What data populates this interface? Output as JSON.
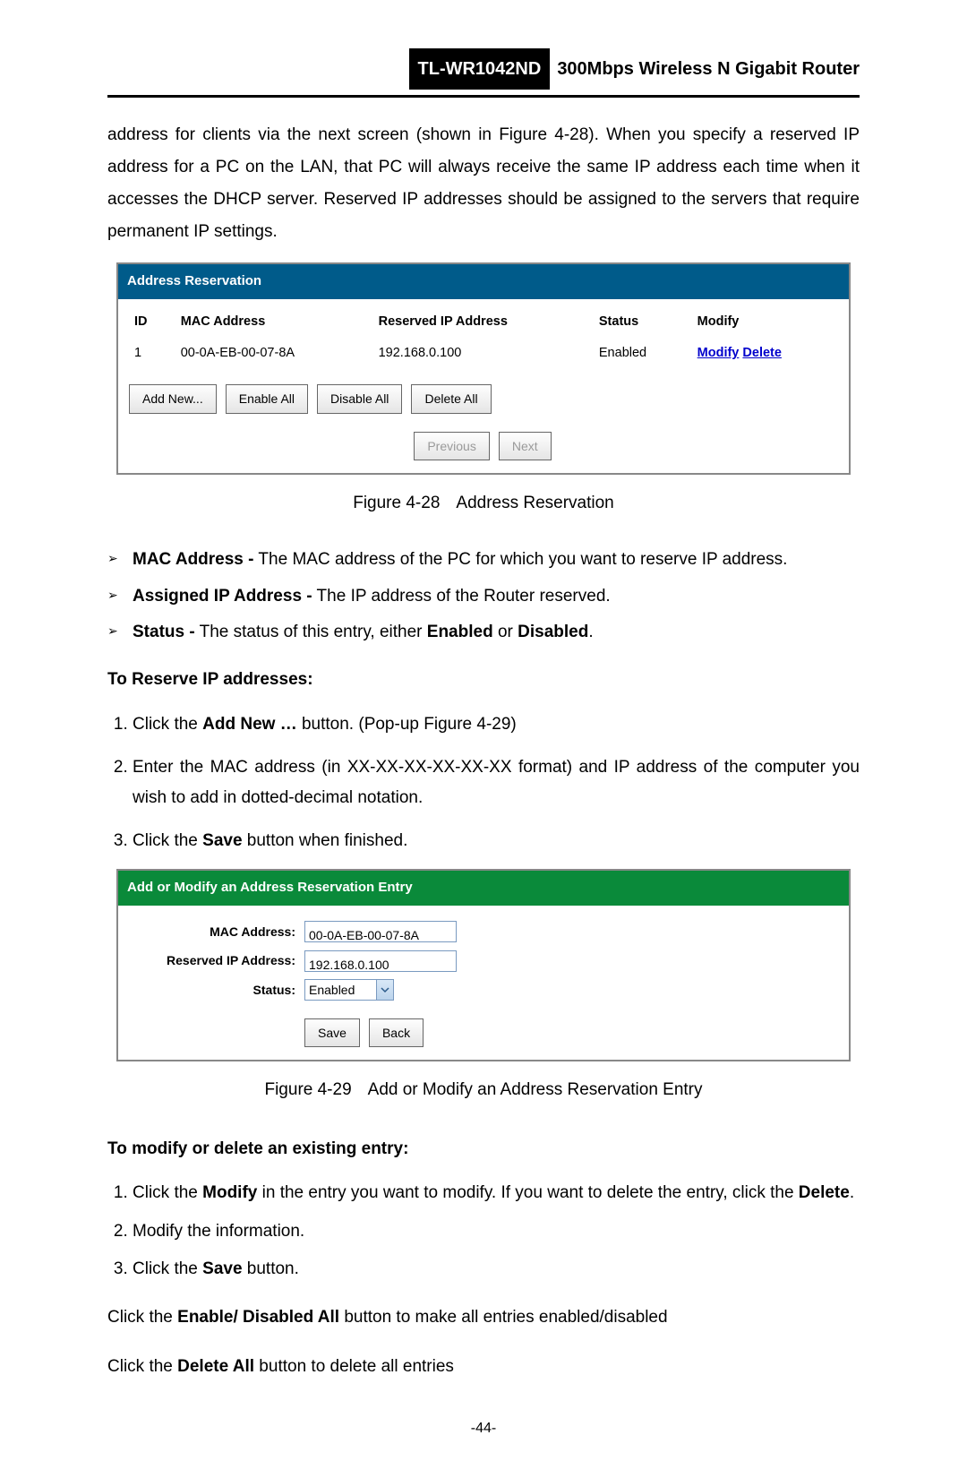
{
  "header": {
    "model": "TL-WR1042ND",
    "desc": "300Mbps Wireless N Gigabit Router"
  },
  "intro": "address for clients via the next screen (shown in Figure 4-28). When you specify a reserved IP address for a PC on the LAN, that PC will always receive the same IP address each time when it accesses the DHCP server. Reserved IP addresses should be assigned to the servers that require permanent IP settings.",
  "fig28": {
    "title": "Address Reservation",
    "cols": {
      "id": "ID",
      "mac": "MAC Address",
      "ip": "Reserved IP Address",
      "status": "Status",
      "modify": "Modify"
    },
    "row": {
      "id": "1",
      "mac": "00-0A-EB-00-07-8A",
      "ip": "192.168.0.100",
      "status": "Enabled",
      "modify_link": "Modify",
      "delete_link": "Delete"
    },
    "btn_add": "Add New...",
    "btn_enable": "Enable All",
    "btn_disable": "Disable All",
    "btn_delete": "Delete All",
    "btn_prev": "Previous",
    "btn_next": "Next",
    "caption_fig": "Figure 4-28",
    "caption_txt": "Address Reservation"
  },
  "bullets": [
    {
      "term": "MAC Address -",
      "desc": " The MAC address of the PC for which you want to reserve IP address."
    },
    {
      "term": "Assigned IP Address -",
      "desc": " The IP address of the Router reserved."
    },
    {
      "term": "Status -",
      "desc_pre": " The status of this entry, either ",
      "b1": "Enabled",
      "mid": " or ",
      "b2": "Disabled",
      "post": "."
    }
  ],
  "reserve": {
    "heading": "To Reserve IP addresses:",
    "step1_pre": "Click the ",
    "step1_b": "Add New …",
    "step1_post": " button. (Pop-up Figure 4-29)",
    "step2": "Enter the MAC address (in XX-XX-XX-XX-XX-XX format) and IP address of the computer you wish to add in dotted-decimal notation.",
    "step3_pre": "Click the ",
    "step3_b": "Save",
    "step3_post": " button when finished."
  },
  "fig29": {
    "title": "Add or Modify an Address Reservation Entry",
    "lbl_mac": "MAC Address:",
    "lbl_ip": "Reserved IP Address:",
    "lbl_status": "Status:",
    "val_mac": "00-0A-EB-00-07-8A",
    "val_ip": "192.168.0.100",
    "val_status": "Enabled",
    "btn_save": "Save",
    "btn_back": "Back",
    "caption_fig": "Figure 4-29",
    "caption_txt": "Add or Modify an Address Reservation Entry"
  },
  "modify": {
    "heading": "To modify or delete an existing entry:",
    "step1_pre": "Click the ",
    "step1_b1": "Modify",
    "step1_mid": " in the entry you want to modify. If you want to delete the entry, click the ",
    "step1_b2": "Delete",
    "step1_post": ".",
    "step2": "Modify the information.",
    "step3_pre": "Click the ",
    "step3_b": "Save",
    "step3_post": " button."
  },
  "footer": {
    "line1_pre": "Click the ",
    "line1_b": "Enable/ Disabled All",
    "line1_post": " button to make all entries enabled/disabled",
    "line2_pre": "Click the ",
    "line2_b": "Delete All",
    "line2_post": " button to delete all entries",
    "pageno": "-44-"
  }
}
